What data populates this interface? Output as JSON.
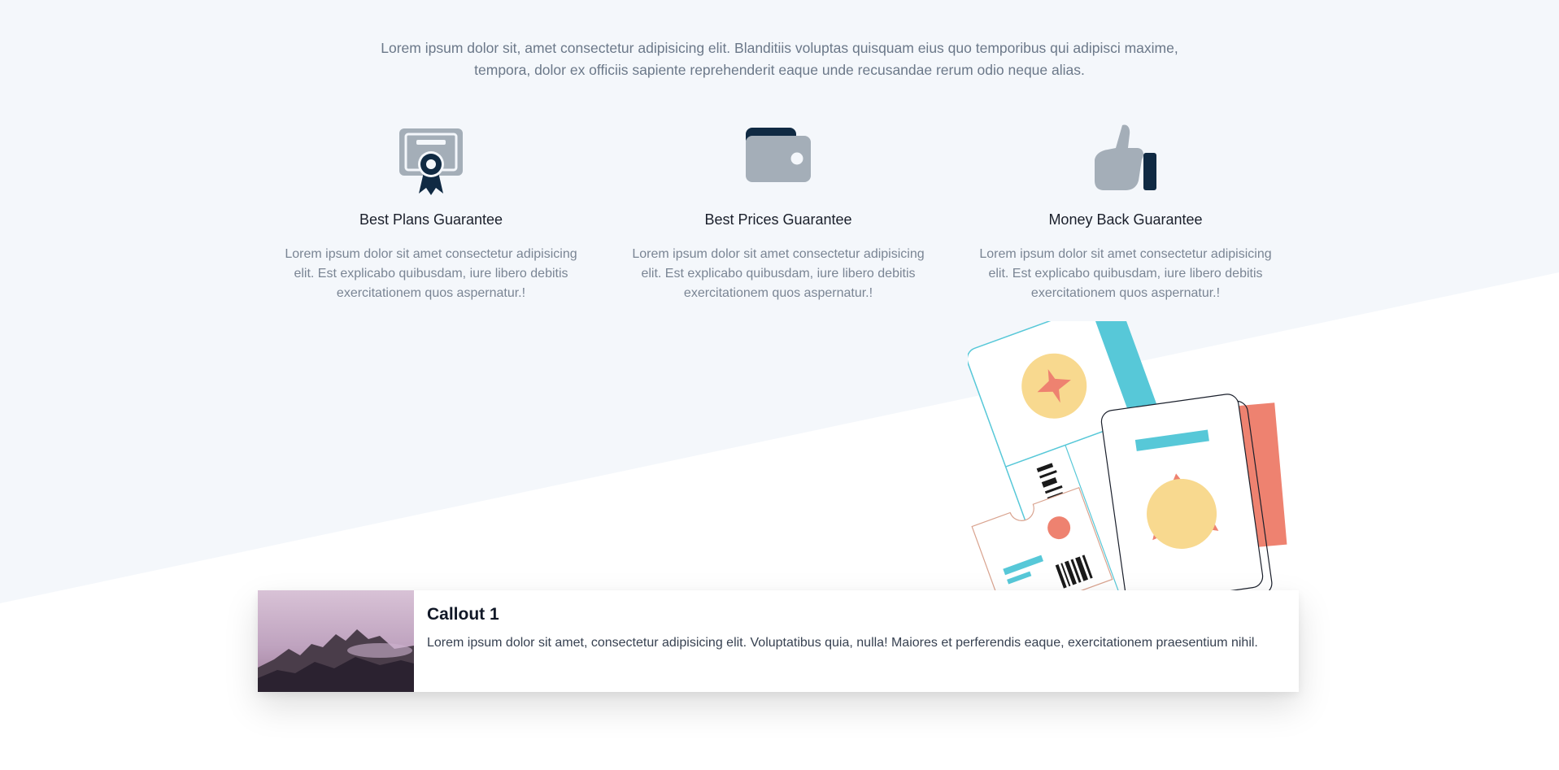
{
  "intro": {
    "text": "Lorem ipsum dolor sit, amet consectetur adipisicing elit. Blanditiis voluptas quisquam eius quo temporibus qui adipisci maxime, tempora, dolor ex officiis sapiente reprehenderit eaque unde recusandae rerum odio neque alias."
  },
  "features": [
    {
      "icon": "certificate-icon",
      "title": "Best Plans Guarantee",
      "description": "Lorem ipsum dolor sit amet consectetur adipisicing elit. Est explicabo quibusdam, iure libero debitis exercitationem quos aspernatur.!"
    },
    {
      "icon": "wallet-icon",
      "title": "Best Prices Guarantee",
      "description": "Lorem ipsum dolor sit amet consectetur adipisicing elit. Est explicabo quibusdam, iure libero debitis exercitationem quos aspernatur.!"
    },
    {
      "icon": "thumbs-up-icon",
      "title": "Money Back Guarantee",
      "description": "Lorem ipsum dolor sit amet consectetur adipisicing elit. Est explicabo quibusdam, iure libero debitis exercitationem quos aspernatur.!"
    }
  ],
  "colors": {
    "section_bg": "#f4f7fb",
    "icon_gray": "#a4aeb8",
    "icon_dark": "#102a43",
    "accent_teal": "#57c8d8",
    "accent_coral": "#ee8270",
    "accent_yellow": "#f8d98f"
  },
  "callout": {
    "title": "Callout 1",
    "text": "Lorem ipsum dolor sit amet, consectetur adipisicing elit. Voluptatibus quia, nulla! Maiores et perferendis eaque, exercitationem praesentium nihil."
  }
}
